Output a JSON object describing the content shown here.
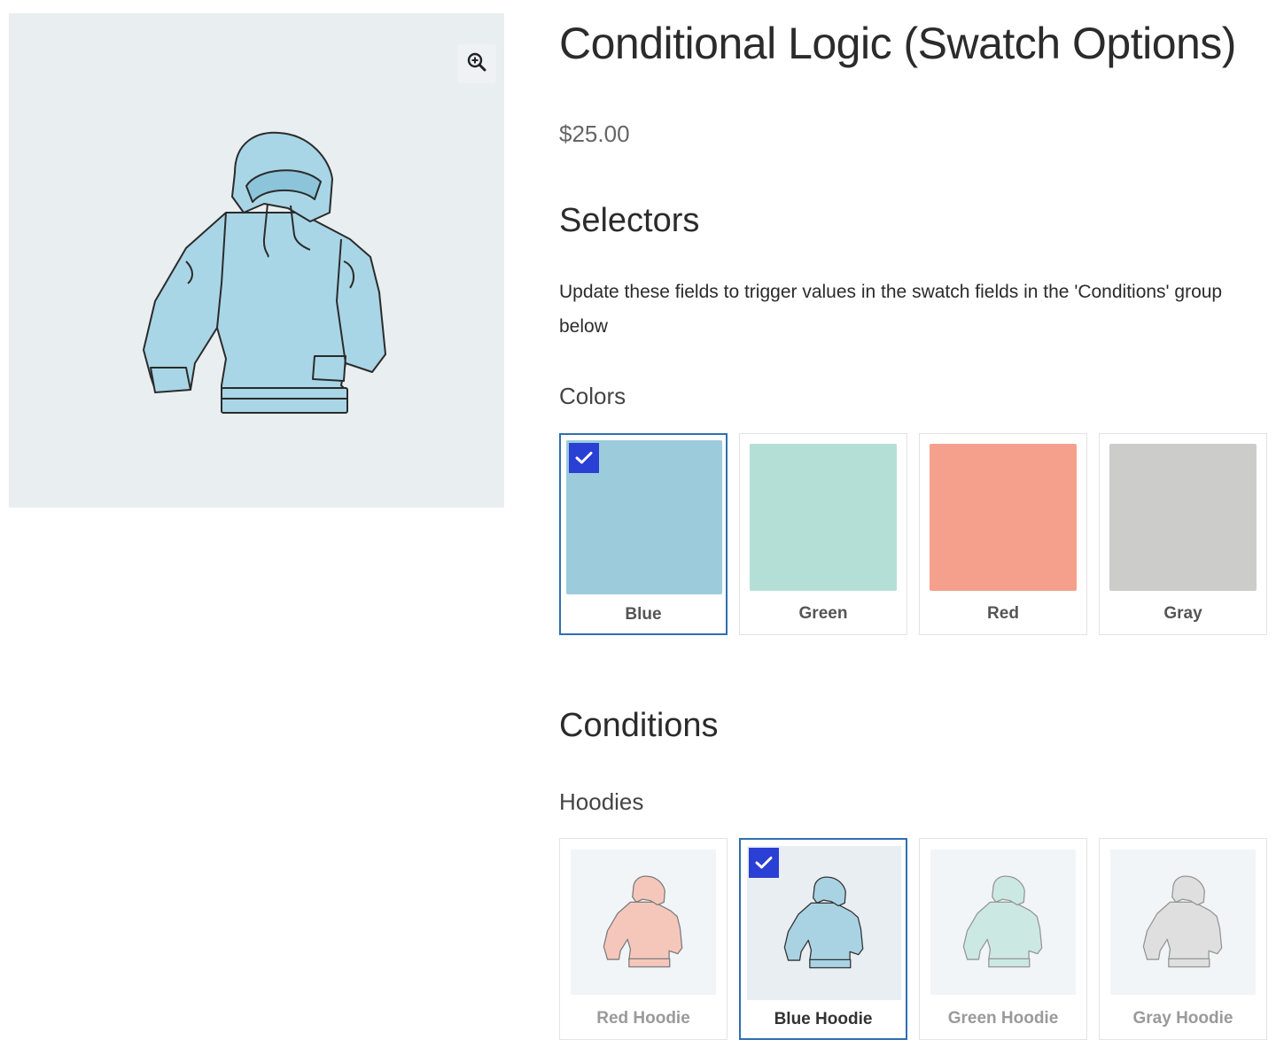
{
  "product": {
    "title": "Conditional Logic (Swatch Options)",
    "price": "$25.00",
    "image_icon": "hoodie-illustration",
    "zoom_icon": "zoom-in-icon"
  },
  "selectors": {
    "heading": "Selectors",
    "description": "Update these fields to trigger values in the swatch fields in the 'Conditions' group below",
    "colors_label": "Colors",
    "colors": [
      {
        "label": "Blue",
        "color": "#9ccbdb",
        "selected": true
      },
      {
        "label": "Green",
        "color": "#b4dfd6",
        "selected": false
      },
      {
        "label": "Red",
        "color": "#f5a08d",
        "selected": false
      },
      {
        "label": "Gray",
        "color": "#cccccb",
        "selected": false
      }
    ]
  },
  "conditions": {
    "heading": "Conditions",
    "hoodies_label": "Hoodies",
    "hoodies": [
      {
        "label": "Red Hoodie",
        "color": "#f7b8a8",
        "selected": false
      },
      {
        "label": "Blue Hoodie",
        "color": "#a9d3e3",
        "selected": true
      },
      {
        "label": "Green Hoodie",
        "color": "#bfe6dc",
        "selected": false
      },
      {
        "label": "Gray Hoodie",
        "color": "#d8d8d6",
        "selected": false
      }
    ]
  },
  "colors": {
    "accent_border": "#2f6fb0",
    "check_bg": "#2a3fd3",
    "gallery_bg": "#e9eef1"
  }
}
